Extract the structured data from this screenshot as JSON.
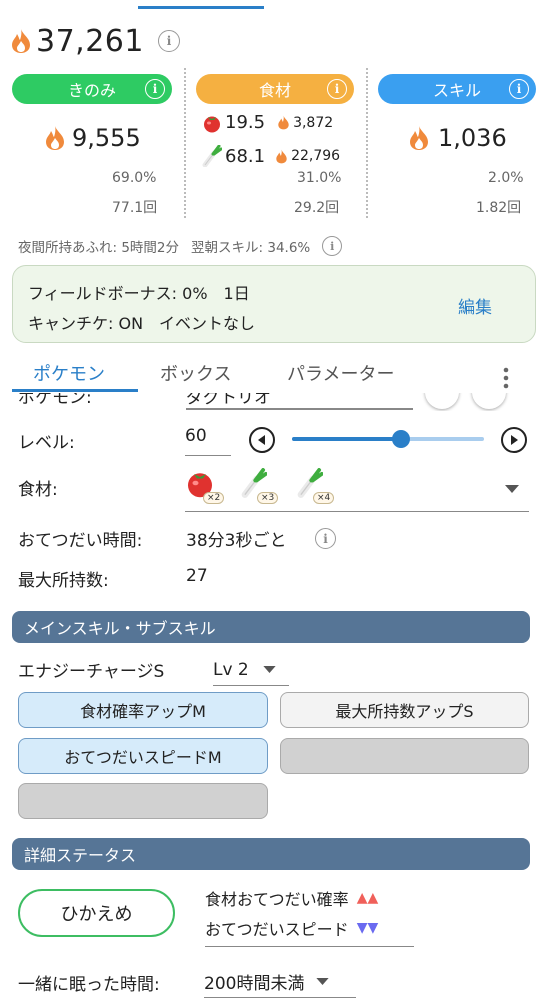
{
  "total_strength": "37,261",
  "categories": {
    "berry": {
      "label": "きのみ",
      "value": "9,555",
      "percent": "69.0%",
      "count": "77.1回",
      "color": "#2ecb63"
    },
    "ingredient": {
      "label": "食材",
      "items": [
        {
          "icon": "tomato-icon",
          "amount": "19.5",
          "strength": "3,872"
        },
        {
          "icon": "leek-icon",
          "amount": "68.1",
          "strength": "22,796"
        }
      ],
      "percent": "31.0%",
      "count": "29.2回",
      "color": "#f5b041"
    },
    "skill": {
      "label": "スキル",
      "value": "1,036",
      "percent": "2.0%",
      "count": "1.82回",
      "color": "#3a9ff0"
    }
  },
  "night_note": "夜間所持あふれ: 5時間2分",
  "morning_note": "翌朝スキル: 34.6%",
  "bonus": {
    "line1": "フィールドボーナス: 0%　1日",
    "line2": "キャンチケ: ON　イベントなし",
    "edit": "編集"
  },
  "tabs": [
    "ポケモン",
    "ボックス",
    "パラメーター"
  ],
  "pokemon": {
    "name_label_partial": "ポケモン:",
    "name_value_partial": "ダグトリオ",
    "level_label": "レベル:",
    "level_value": "60",
    "level_fraction": 0.57,
    "ingredient_label": "食材:",
    "ingredients": [
      {
        "icon": "tomato-icon",
        "qty": "×2"
      },
      {
        "icon": "leek-icon",
        "qty": "×3"
      },
      {
        "icon": "leek-icon",
        "qty": "×4"
      }
    ],
    "help_label": "おてつだい時間:",
    "help_value": "38分3秒ごと",
    "max_label": "最大所持数:",
    "max_value": "27"
  },
  "skills": {
    "header": "メインスキル・サブスキル",
    "main_skill": "エナジーチャージS",
    "main_level": "Lv 2",
    "sub": [
      "食材確率アップM",
      "最大所持数アップS",
      "おてつだいスピードM"
    ]
  },
  "details": {
    "header": "詳細ステータス",
    "nature": "ひかえめ",
    "up_label": "食材おてつだい確率",
    "up_marks": "▲▲",
    "down_label": "おてつだいスピード",
    "down_marks": "▼▼",
    "sleep_label": "一緒に眠った時間:",
    "sleep_value": "200時間未満"
  }
}
